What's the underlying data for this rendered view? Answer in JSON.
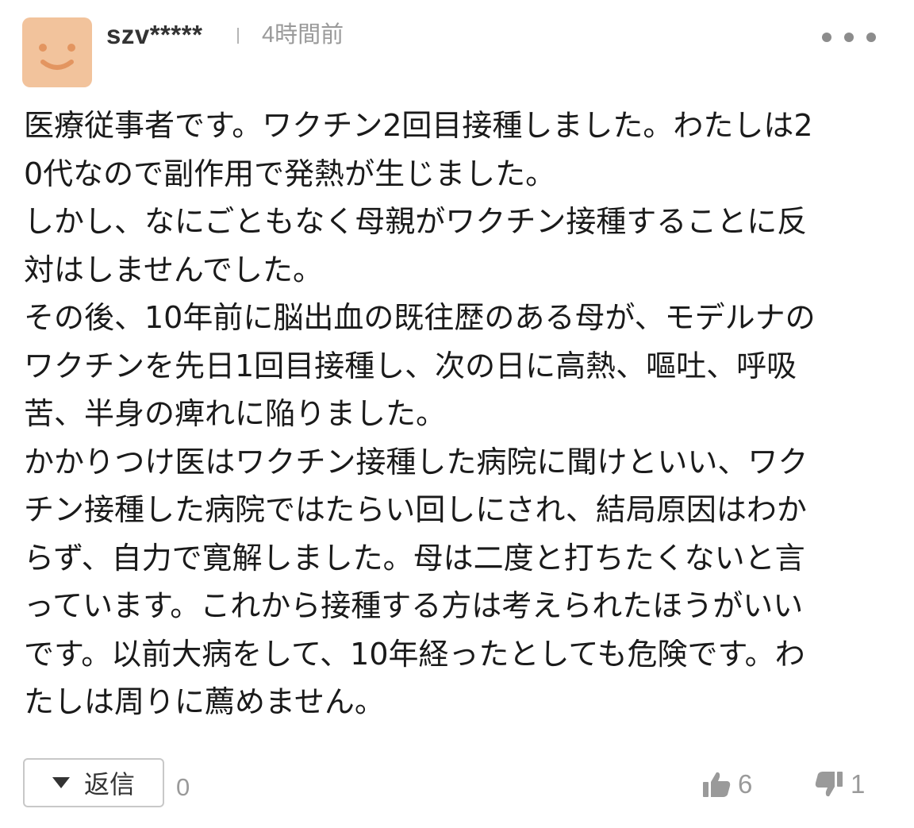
{
  "comment": {
    "user_name": "szv*****",
    "separator": "|",
    "timestamp": "4時間前",
    "body_lines": [
      "医療従事者です。ワクチン2回目接種しました。わたしは2",
      "0代なので副作用で発熱が生じました。",
      "しかし、なにごともなく母親がワクチン接種することに反",
      "対はしませんでした。",
      "その後、10年前に脳出血の既往歴のある母が、モデルナの",
      "ワクチンを先日1回目接種し、次の日に高熱、嘔吐、呼吸",
      "苦、半身の痺れに陥りました。",
      "かかりつけ医はワクチン接種した病院に聞けといい、ワク",
      "チン接種した病院ではたらい回しにされ、結局原因はわか",
      "らず、自力で寛解しました。母は二度と打ちたくないと言",
      "っています。これから接種する方は考えられたほうがいい",
      "です。以前大病をして、10年経ったとしても危険です。わ",
      "たしは周りに薦めません。"
    ]
  },
  "actions": {
    "reply_label": "返信",
    "reply_count": "0",
    "like_count": "6",
    "dislike_count": "1"
  },
  "colors": {
    "avatar_bg": "#f2c39c",
    "avatar_face": "#e39560",
    "text": "#1a1a1a",
    "muted": "#9a9a9a"
  },
  "icons": {
    "avatar": "smiley-face-icon",
    "more": "more-dots-icon",
    "reply": "triangle-down-icon",
    "like": "thumbs-up-icon",
    "dislike": "thumbs-down-icon"
  }
}
